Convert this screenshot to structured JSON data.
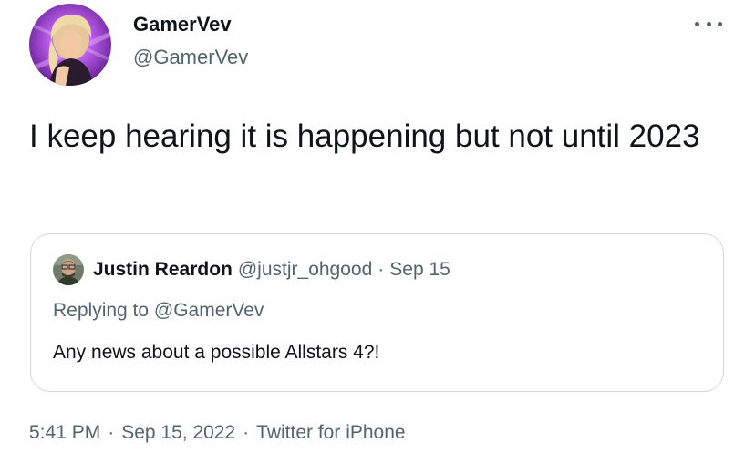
{
  "author": {
    "display_name": "GamerVev",
    "handle": "@GamerVev"
  },
  "tweet": {
    "text": "I keep hearing it is happening but not until 2023"
  },
  "quoted_tweet": {
    "display_name": "Justin Reardon",
    "handle": "@justjr_ohgood",
    "separator": "·",
    "date": "Sep 15",
    "replying_to": "Replying to @GamerVev",
    "text": "Any news about a possible Allstars 4?!"
  },
  "meta": {
    "time": "5:41 PM",
    "separator": "·",
    "date": "Sep 15, 2022",
    "source": "Twitter for iPhone"
  },
  "colors": {
    "text_primary": "#0f1419",
    "text_secondary": "#536471",
    "border": "#cfd9de",
    "avatar_bg": "#a64fd6"
  },
  "icons": {
    "more": "more-horizontal-icon"
  }
}
